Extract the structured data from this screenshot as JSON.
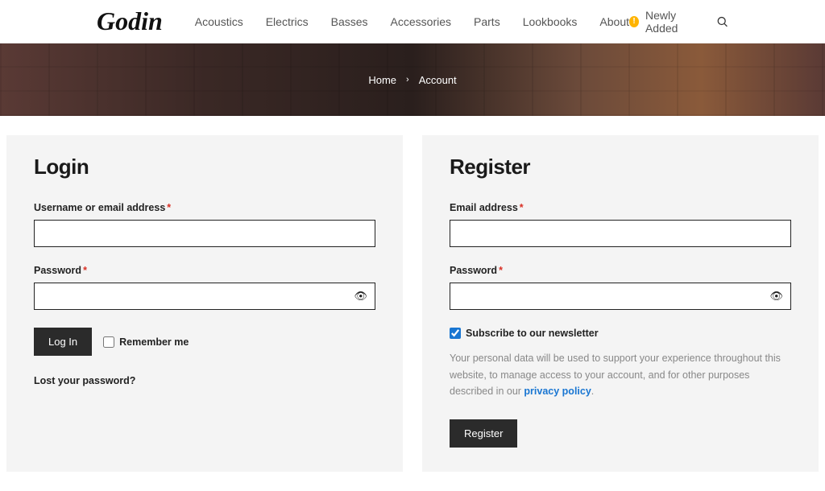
{
  "brand": "Godin",
  "nav": {
    "items": [
      "Acoustics",
      "Electrics",
      "Basses",
      "Accessories",
      "Parts",
      "Lookbooks",
      "About"
    ],
    "newly_added": "Newly Added"
  },
  "breadcrumb": {
    "home": "Home",
    "current": "Account"
  },
  "login": {
    "title": "Login",
    "username_label": "Username or email address",
    "password_label": "Password",
    "submit": "Log In",
    "remember": "Remember me",
    "lost": "Lost your password?",
    "username_value": "",
    "password_value": "",
    "remember_checked": false
  },
  "register": {
    "title": "Register",
    "email_label": "Email address",
    "password_label": "Password",
    "subscribe_label": "Subscribe to our newsletter",
    "subscribe_checked": true,
    "privacy_text": "Your personal data will be used to support your experience throughout this website, to manage access to your account, and for other purposes described in our ",
    "privacy_link": "privacy policy",
    "privacy_after": ".",
    "submit": "Register",
    "email_value": "",
    "password_value": ""
  }
}
